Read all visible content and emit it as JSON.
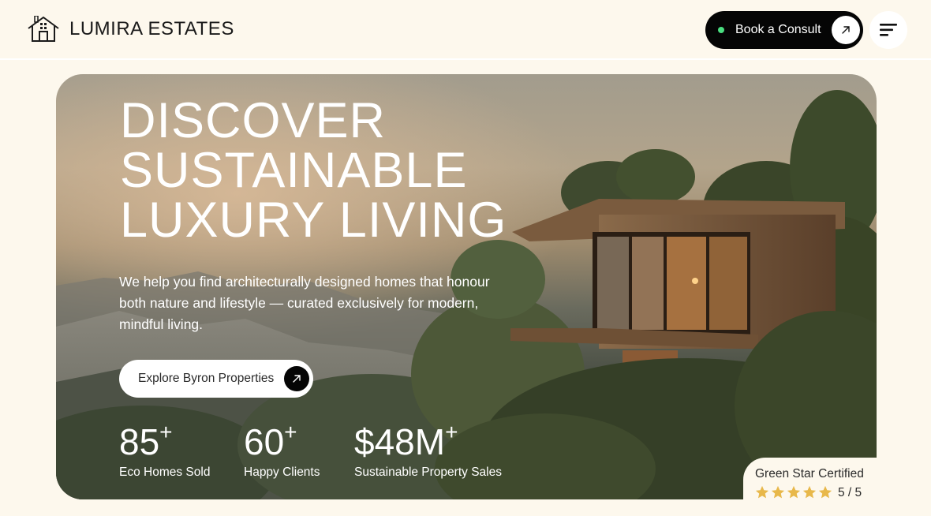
{
  "header": {
    "brand": "LUMIRA ESTATES",
    "logo_icon": "house-icon",
    "cta_label": "Book a Consult",
    "cta_status_color": "#4ade80",
    "cta_icon": "arrow-up-right-icon",
    "menu_icon": "menu-icon"
  },
  "hero": {
    "title": "DISCOVER\nSUSTAINABLE\nLUXURY LIVING",
    "description": "We help you find architecturally designed homes that honour both nature and lifestyle — curated exclusively for modern, mindful living.",
    "explore_label": "Explore Byron Properties",
    "explore_icon": "arrow-up-right-icon",
    "stats": [
      {
        "value": "85",
        "suffix": "+",
        "label": "Eco Homes Sold"
      },
      {
        "value": "60",
        "suffix": "+",
        "label": "Happy Clients"
      },
      {
        "value": "$48M",
        "suffix": "+",
        "label": "Sustainable Property Sales"
      }
    ]
  },
  "badge": {
    "title": "Green Star Certified",
    "score": "5 / 5",
    "rating": 5,
    "star_color": "#e8b84a"
  }
}
